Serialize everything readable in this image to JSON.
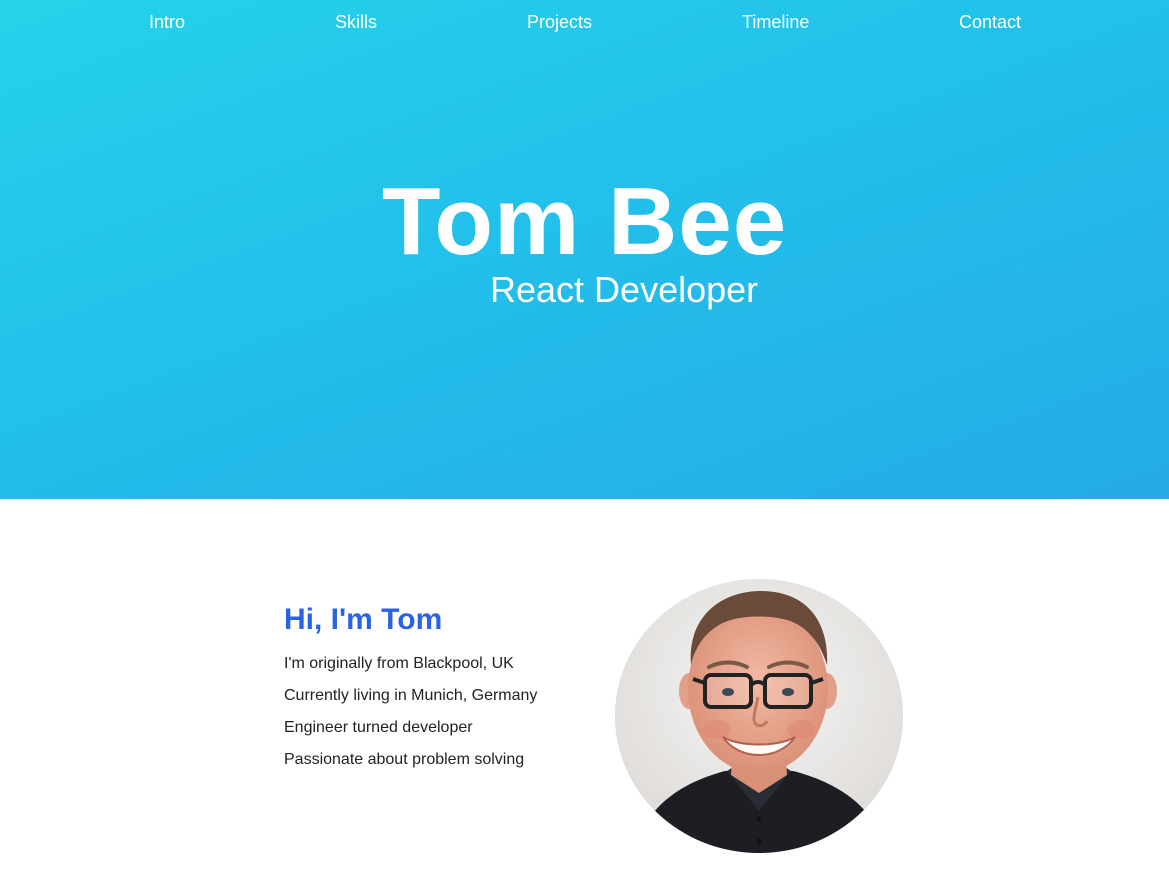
{
  "nav": {
    "items": [
      {
        "label": "Intro"
      },
      {
        "label": "Skills"
      },
      {
        "label": "Projects"
      },
      {
        "label": "Timeline"
      },
      {
        "label": "Contact"
      }
    ]
  },
  "hero": {
    "name": "Tom Bee",
    "role": "React Developer"
  },
  "about": {
    "title": "Hi, I'm Tom",
    "facts": [
      "I'm originally from Blackpool, UK",
      "Currently living in Munich, Germany",
      "Engineer turned developer",
      "Passionate about problem solving"
    ]
  },
  "colors": {
    "hero_gradient_start": "#25d3ea",
    "hero_gradient_end": "#25abe6",
    "accent_heading": "#2a62e4",
    "body_text": "#222222"
  }
}
